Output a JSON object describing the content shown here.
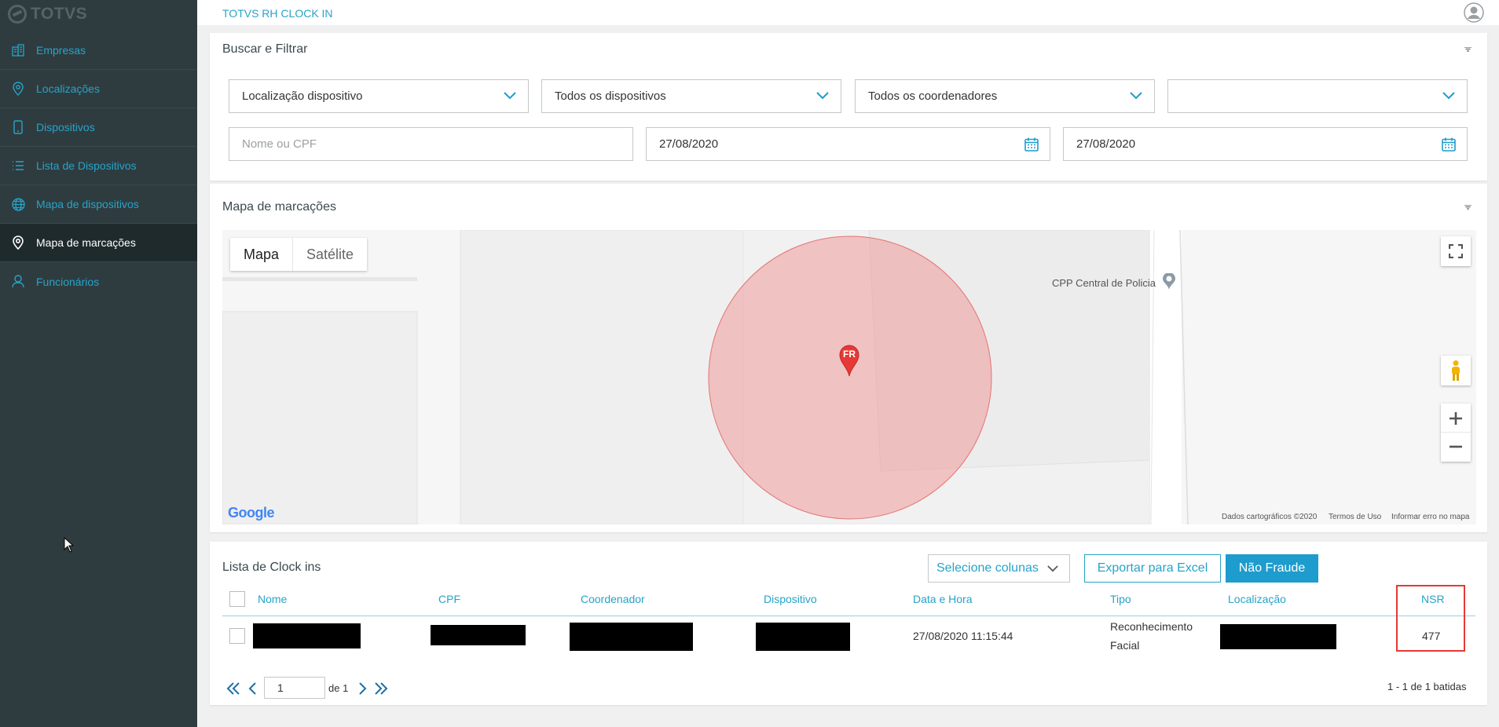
{
  "brand": {
    "name": "TOTVS",
    "app_title": "TOTVS RH CLOCK IN"
  },
  "sidebar": {
    "items": [
      {
        "label": "Empresas",
        "icon": "building-icon"
      },
      {
        "label": "Localizações",
        "icon": "location-pin-icon"
      },
      {
        "label": "Dispositivos",
        "icon": "phone-icon"
      },
      {
        "label": "Lista de Dispositivos",
        "icon": "list-icon"
      },
      {
        "label": "Mapa de dispositivos",
        "icon": "globe-icon"
      },
      {
        "label": "Mapa de marcações",
        "icon": "location-pin-icon",
        "active": true
      },
      {
        "label": "Funcionários",
        "icon": "user-icon"
      }
    ]
  },
  "filter": {
    "title": "Buscar e Filtrar",
    "location_select": "Localização dispositivo",
    "device_select": "Todos os dispositivos",
    "coordinator_select": "Todos os coordenadores",
    "extra_select": "",
    "name_placeholder": "Nome ou CPF",
    "date_start": "27/08/2020",
    "date_end": "27/08/2020"
  },
  "map": {
    "title": "Mapa de marcações",
    "type_map": "Mapa",
    "type_satellite": "Satélite",
    "poi_label": "CPP Central de Policia",
    "marker_label": "FR",
    "google": "Google",
    "footer": {
      "data": "Dados cartográficos ©2020",
      "terms": "Termos de Uso",
      "report": "Informar erro no mapa"
    }
  },
  "list": {
    "title": "Lista de Clock ins",
    "columns_select": "Selecione colunas",
    "export_button": "Exportar para Excel",
    "not_fraud_button": "Não Fraude",
    "headers": {
      "nome": "Nome",
      "cpf": "CPF",
      "coordenador": "Coordenador",
      "dispositivo": "Dispositivo",
      "data_hora": "Data e Hora",
      "tipo": "Tipo",
      "localizacao": "Localização",
      "nsr": "NSR"
    },
    "rows": [
      {
        "data_hora": "27/08/2020 11:15:44",
        "tipo_1": "Reconhecimento",
        "tipo_2": "Facial",
        "nsr": "477"
      }
    ],
    "pager": {
      "page": "1",
      "of": "de 1",
      "summary": "1 - 1 de 1 batidas"
    }
  },
  "colors": {
    "sidebar": "#2f3c3f",
    "accent": "#27a3c9",
    "primary": "#1d9ccd",
    "highlight": "#e53935"
  }
}
